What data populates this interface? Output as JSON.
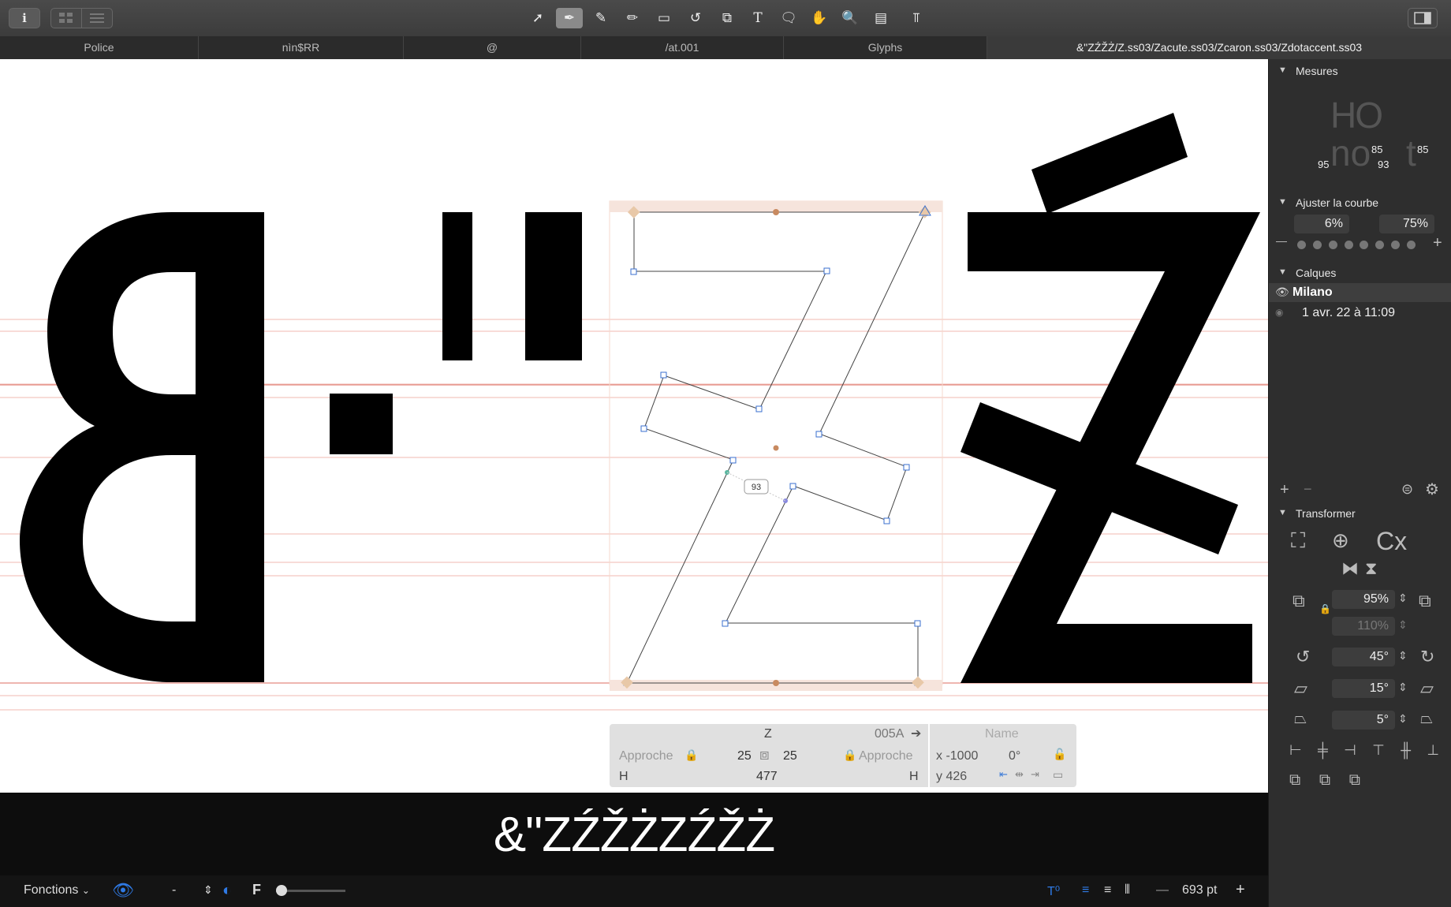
{
  "toolbar": {
    "info_label": "i",
    "grid_icon": "grid-icon",
    "list_icon": "list-icon",
    "tools": [
      "pointer-icon",
      "pen-icon",
      "brush-icon",
      "pencil-icon",
      "rectangle-icon",
      "rotate-icon",
      "scale-icon",
      "text-icon",
      "speech-bubble-icon",
      "hand-icon",
      "zoom-icon",
      "ruler-icon",
      "text-tool-icon"
    ],
    "sidebar_toggle_icon": "sidebar-toggle-icon"
  },
  "tabs": [
    "Police",
    "nìn$RR",
    "@",
    "/at.001",
    "Glyphs",
    "&\"ZŹŽŻ/Z.ss03/Zacute.ss03/Zcaron.ss03/Zdotaccent.ss03"
  ],
  "canvas": {
    "distance_label": "93"
  },
  "glyph_info": {
    "glyph": "Z",
    "unicode": "005A",
    "name_placeholder": "Name",
    "approche_left": "Approche",
    "approche_right": "Approche",
    "lsb": "25",
    "rsb": "25",
    "h_left": "H",
    "h_right": "H",
    "width": "477",
    "x": "x -1000",
    "angle": "0°",
    "y": "y 426"
  },
  "preview": {
    "text": "&\"ZŹŽŻZŹŽŻ"
  },
  "statusbar": {
    "fonctions": "Fonctions",
    "minus": "-",
    "f_label": "F",
    "size": "693 pt",
    "minus2": "—",
    "plus": "+"
  },
  "panel": {
    "mesures": {
      "title": "Mesures",
      "HO": "HO",
      "no": "no",
      "t": "t",
      "n95": "95",
      "n85a": "85",
      "n93": "93",
      "n85b": "85"
    },
    "ajuster": {
      "title": "Ajuster la courbe",
      "v1": "6%",
      "v2": "75%",
      "minus": "—",
      "plus": "+"
    },
    "calques": {
      "title": "Calques",
      "layer1": "Milano",
      "layer2": "1 avr. 22 à 11:09"
    },
    "transformer": {
      "title": "Transformer",
      "cx": "Cx",
      "scale1": "95%",
      "scale2": "110%",
      "rotate": "45°",
      "slant1": "15°",
      "slant2": "5°"
    }
  }
}
